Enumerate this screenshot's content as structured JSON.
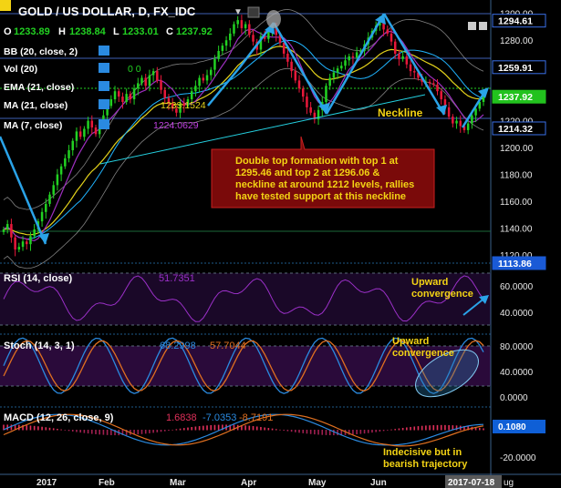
{
  "header": {
    "title": "GOLD / US DOLLAR, D, FX_IDC",
    "ohlc": {
      "o_label": "O",
      "o": "1233.89",
      "h_label": "H",
      "h": "1238.84",
      "l_label": "L",
      "l": "1233.01",
      "c_label": "C",
      "c": "1237.92"
    }
  },
  "indicators": {
    "bb": {
      "label": "BB (20, close, 2)"
    },
    "vol": {
      "label": "Vol (20)",
      "v1": "0",
      "v2": "0"
    },
    "ema": {
      "label": "EMA (21, close)"
    },
    "ma21": {
      "label": "MA (21, close)",
      "value": "1233.1524"
    },
    "ma7": {
      "label": "MA (7, close)",
      "value": "1224.0629"
    }
  },
  "annotations": {
    "neckline": "Neckline",
    "callout": [
      "Double top formation with top 1 at",
      "1295.46 and top 2 at 1296.06 &",
      "neckline at around 1212 levels, rallies",
      "have tested support at this neckline"
    ],
    "rsi_note": [
      "Upward",
      "convergence"
    ],
    "stoch_note": [
      "Upward",
      "convergence"
    ],
    "macd_note": [
      "Indecisive but in",
      "bearish trajectory"
    ]
  },
  "rsi": {
    "label": "RSI (14, close)",
    "value": "51.7351",
    "ticks": [
      "60.0000",
      "40.0000"
    ]
  },
  "stoch": {
    "label": "Stoch (14, 3, 1)",
    "k": "68.2998",
    "d": "57.7044",
    "ticks": [
      "80.0000",
      "40.0000",
      "0.0000"
    ]
  },
  "macd": {
    "label": "MACD (12, 26, close, 9)",
    "hist": "1.6838",
    "macd": "-7.0353",
    "signal": "-8.7191",
    "tick_neg": "-20.0000",
    "badge": "0.1080"
  },
  "price_badges": [
    {
      "text": "1294.61",
      "y": 1294.61,
      "style": "outline"
    },
    {
      "text": "1259.91",
      "y": 1259.91,
      "style": "outline"
    },
    {
      "text": "1237.92",
      "y": 1237.92,
      "style": "green"
    },
    {
      "text": "1214.32",
      "y": 1214.32,
      "style": "outline"
    },
    {
      "text": "1113.86",
      "y": 1113.86,
      "style": "blue"
    }
  ],
  "x_axis": {
    "labels": [
      "2017",
      "Feb",
      "Mar",
      "Apr",
      "May",
      "Jun",
      "Jul"
    ],
    "date_badge": "2017-07-18",
    "tail": "ug"
  },
  "colors": {
    "up": "#22d122",
    "down": "#e8183a",
    "bb": "#d7d7d7",
    "ema": "#e3d21b",
    "ma21": "#20b4ff",
    "ma7": "#9d2fbf",
    "accent": "#1aa3d8",
    "callout_bg": "#7a0a0a",
    "callout_text": "#f3d314"
  },
  "chart_data": {
    "type": "candlestick",
    "title": "GOLD / US DOLLAR, D, FX_IDC",
    "y_range": [
      1113.86,
      1310
    ],
    "y_ticks": [
      1120,
      1140,
      1160,
      1180,
      1200,
      1220,
      1240,
      1260,
      1280,
      1300
    ],
    "x_period": [
      "2016-12",
      "2017-07-18"
    ],
    "close_series": [
      1139,
      1143,
      1133,
      1124,
      1126,
      1130,
      1128,
      1134,
      1139,
      1145,
      1152,
      1158,
      1165,
      1172,
      1180,
      1186,
      1192,
      1198,
      1205,
      1212,
      1208,
      1214,
      1220,
      1215,
      1210,
      1218,
      1224,
      1231,
      1236,
      1242,
      1238,
      1234,
      1240,
      1236,
      1244,
      1248,
      1252,
      1246,
      1254,
      1257,
      1250,
      1243,
      1237,
      1233,
      1229,
      1226,
      1233,
      1231,
      1236,
      1242,
      1246,
      1252,
      1250,
      1254,
      1258,
      1266,
      1272,
      1276,
      1280,
      1285,
      1292,
      1295,
      1289,
      1292,
      1284,
      1279,
      1273,
      1283,
      1281,
      1287,
      1289,
      1284,
      1278,
      1270,
      1264,
      1257,
      1250,
      1244,
      1238,
      1230,
      1226,
      1221,
      1228,
      1234,
      1246,
      1252,
      1256,
      1259,
      1261,
      1265,
      1268,
      1267,
      1271,
      1272,
      1277,
      1282,
      1287,
      1291,
      1294,
      1288,
      1285,
      1279,
      1270,
      1266,
      1268,
      1262,
      1257,
      1256,
      1252,
      1249,
      1249,
      1248,
      1247,
      1242,
      1236,
      1230,
      1223,
      1218,
      1220,
      1216,
      1213,
      1218,
      1224,
      1229,
      1234,
      1238
    ],
    "annotations": {
      "top_1": 1295.46,
      "top_2": 1296.06,
      "neckline": 1212
    },
    "rsi": {
      "value": 51.7351,
      "range": [
        30,
        70
      ]
    },
    "stoch": {
      "k": 68.2998,
      "d": 57.7044,
      "range": [
        0,
        100
      ]
    },
    "macd": {
      "hist": 1.6838,
      "macd": -7.0353,
      "signal": -8.7191
    }
  }
}
